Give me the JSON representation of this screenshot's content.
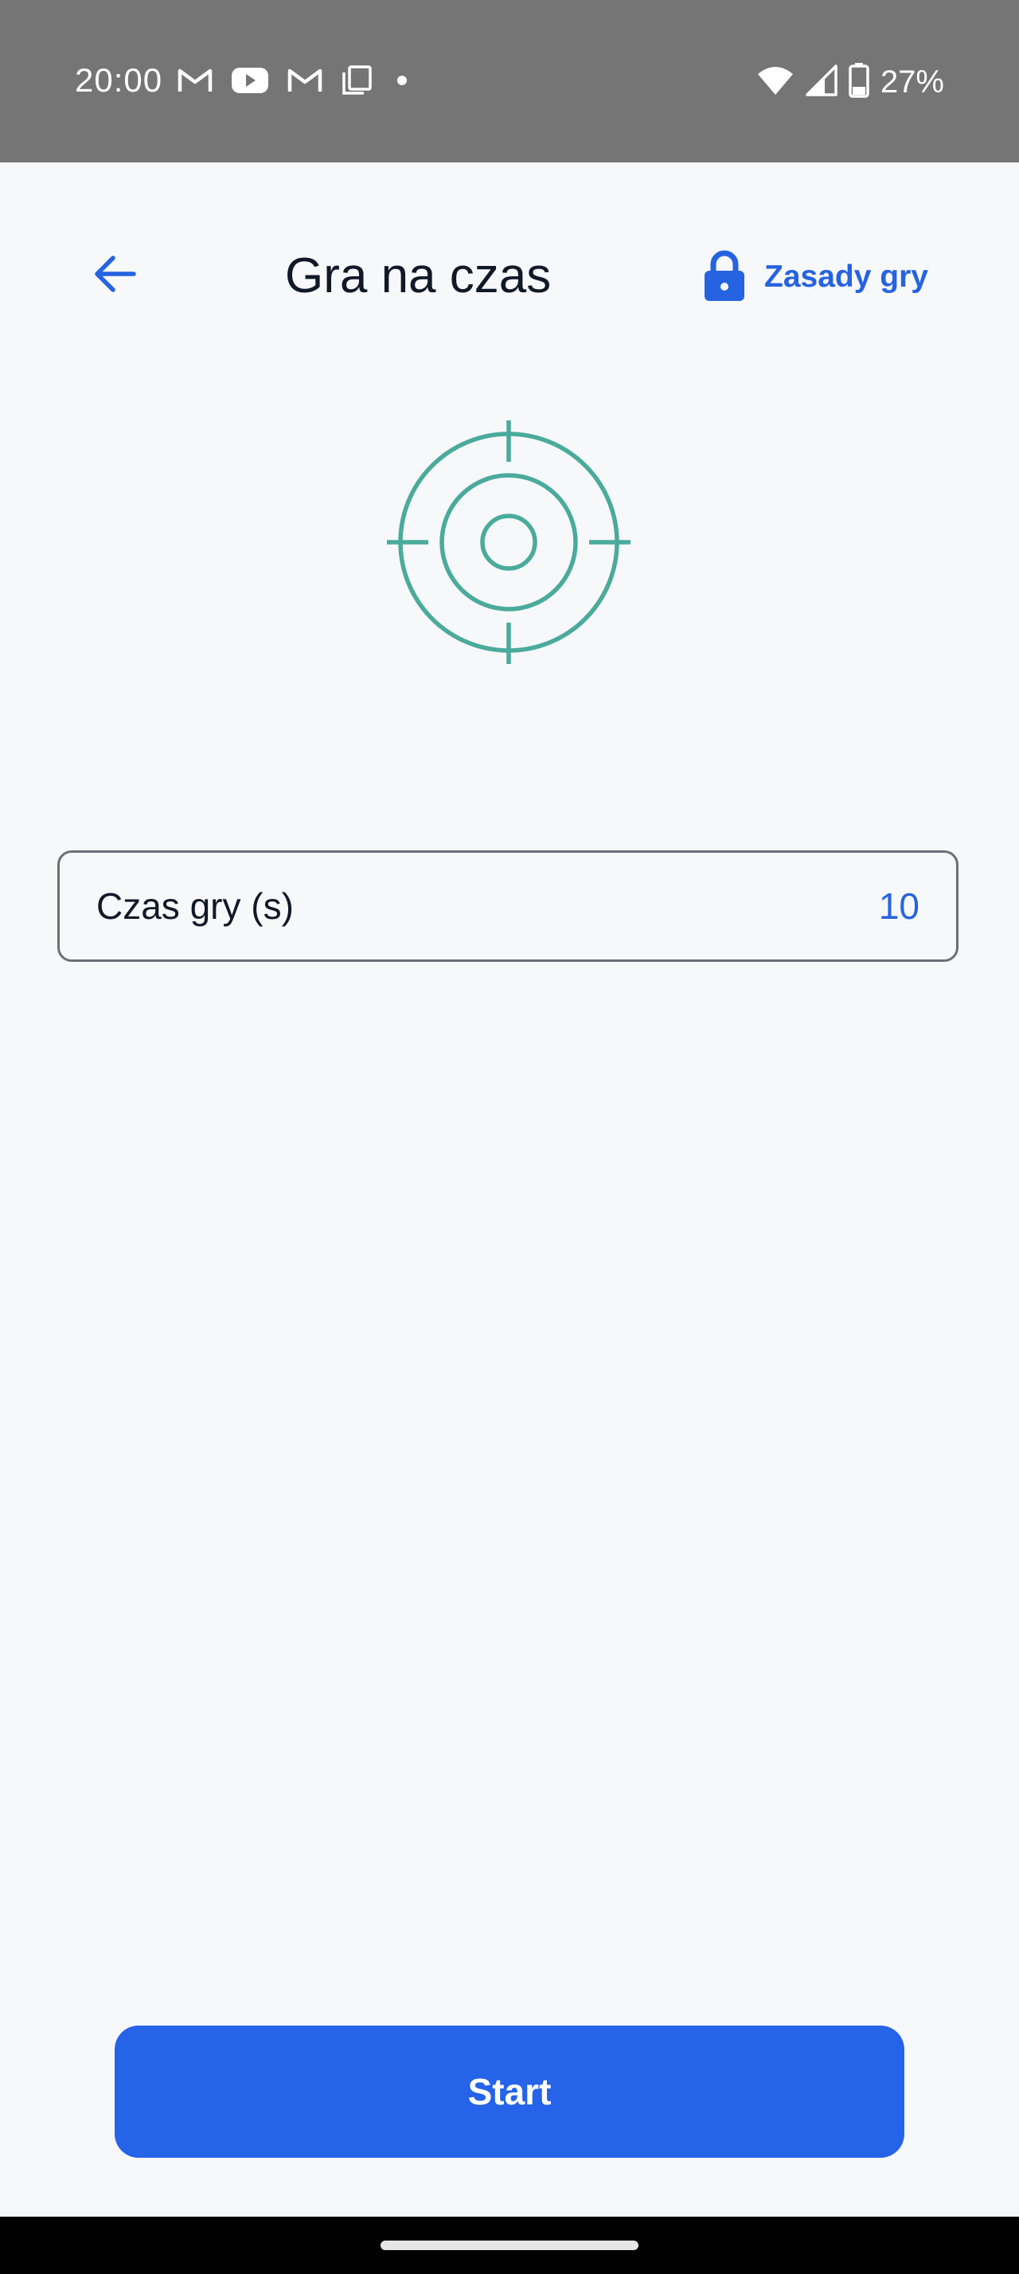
{
  "status_bar": {
    "time": "20:00",
    "left_icons": [
      "gmail-icon",
      "youtube-icon",
      "gmail-icon",
      "copy-icon",
      "dot-icon"
    ],
    "right_icons": [
      "wifi-icon",
      "signal-icon",
      "battery-icon"
    ],
    "battery": "27%"
  },
  "header": {
    "back_icon": "arrow-left-icon",
    "title": "Gra na czas",
    "rules_icon": "lock-icon",
    "rules_label": "Zasady gry"
  },
  "hero": {
    "icon": "target-icon",
    "color": "#4aab9c"
  },
  "time_field": {
    "label": "Czas gry (s)",
    "value": "10"
  },
  "start_button": {
    "label": "Start"
  },
  "colors": {
    "accent": "#2563e8",
    "status_bar": "#757575",
    "background": "#f7f8fa",
    "target": "#4aab9c"
  }
}
